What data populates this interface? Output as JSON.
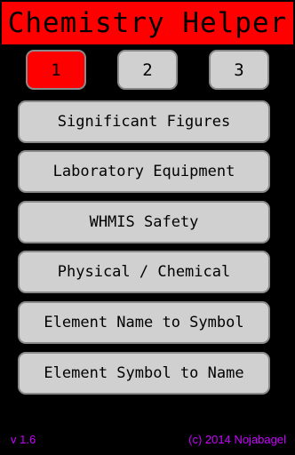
{
  "app": {
    "title": "Chemistry Helper"
  },
  "pages": [
    {
      "label": "1",
      "active": true
    },
    {
      "label": "2",
      "active": false
    },
    {
      "label": "3",
      "active": false
    }
  ],
  "menu": [
    {
      "label": "Significant Figures"
    },
    {
      "label": "Laboratory Equipment"
    },
    {
      "label": "WHMIS Safety"
    },
    {
      "label": "Physical / Chemical"
    },
    {
      "label": "Element Name to Symbol"
    },
    {
      "label": "Element Symbol to Name"
    }
  ],
  "footer": {
    "version": "v 1.6",
    "copyright": "(c) 2014 Nojabagel"
  },
  "colors": {
    "background": "#000000",
    "title_bar": "#ff0000",
    "active_page": "#ff0000",
    "button": "#d0d0d0",
    "footer_text": "#c800ff"
  }
}
